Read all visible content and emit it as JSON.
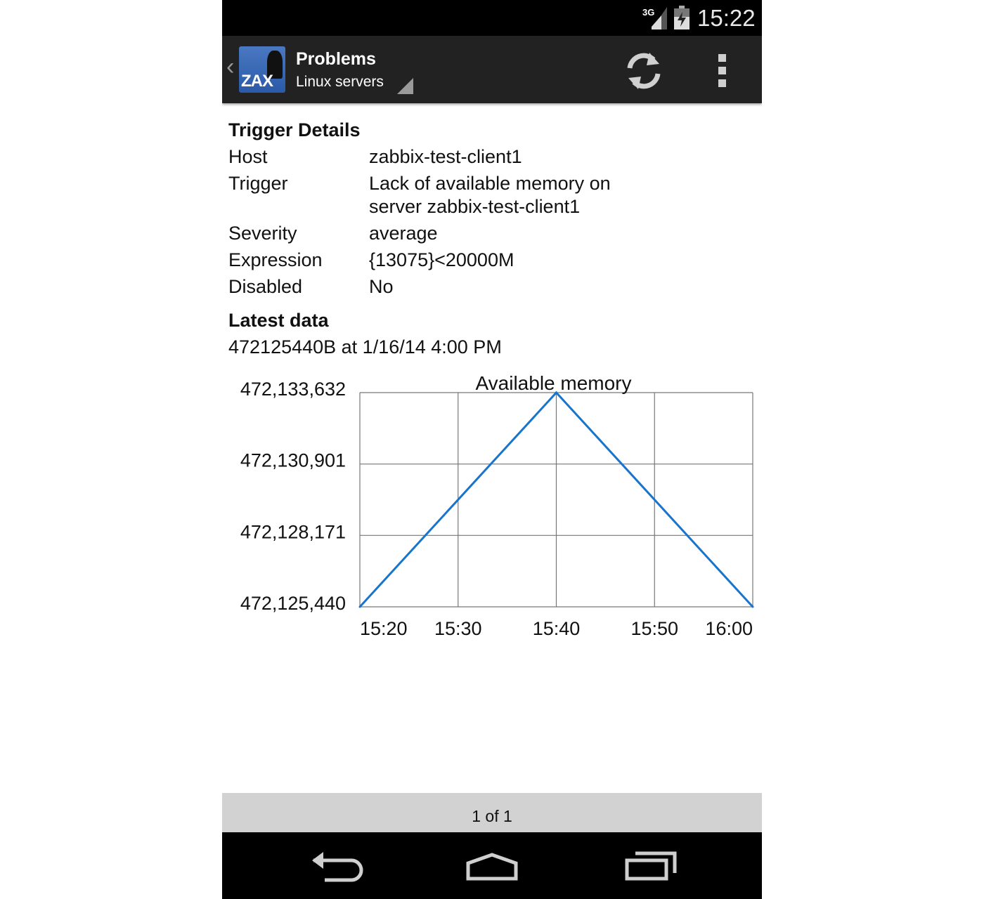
{
  "status_bar": {
    "network": "3G",
    "time": "15:22"
  },
  "action_bar": {
    "logo_text": "ZAX",
    "title": "Problems",
    "subtitle": "Linux servers"
  },
  "details": {
    "heading": "Trigger Details",
    "rows": [
      {
        "label": "Host",
        "value": "zabbix-test-client1"
      },
      {
        "label": "Trigger",
        "value_line1": "Lack of available memory on",
        "value_line2": "server zabbix-test-client1"
      },
      {
        "label": "Severity",
        "value": "average"
      },
      {
        "label": "Expression",
        "value": "{13075}<20000M"
      },
      {
        "label": "Disabled",
        "value": "No"
      }
    ]
  },
  "latest": {
    "heading": "Latest data",
    "value": "472125440B at 1/16/14 4:00 PM"
  },
  "chart_data": {
    "type": "line",
    "title": "Available memory",
    "x": [
      "15:20",
      "15:40",
      "16:00"
    ],
    "series": [
      {
        "values": [
          472125440,
          472133632,
          472125440
        ]
      }
    ],
    "x_ticks": [
      "15:20",
      "15:30",
      "15:40",
      "15:50",
      "16:00"
    ],
    "y_ticks": [
      "472,125,440",
      "472,128,171",
      "472,130,901",
      "472,133,632"
    ],
    "ylim": [
      472125440,
      472133632
    ],
    "grid": true,
    "line_color": "#1874cd"
  },
  "pager": {
    "label": "1 of 1"
  }
}
